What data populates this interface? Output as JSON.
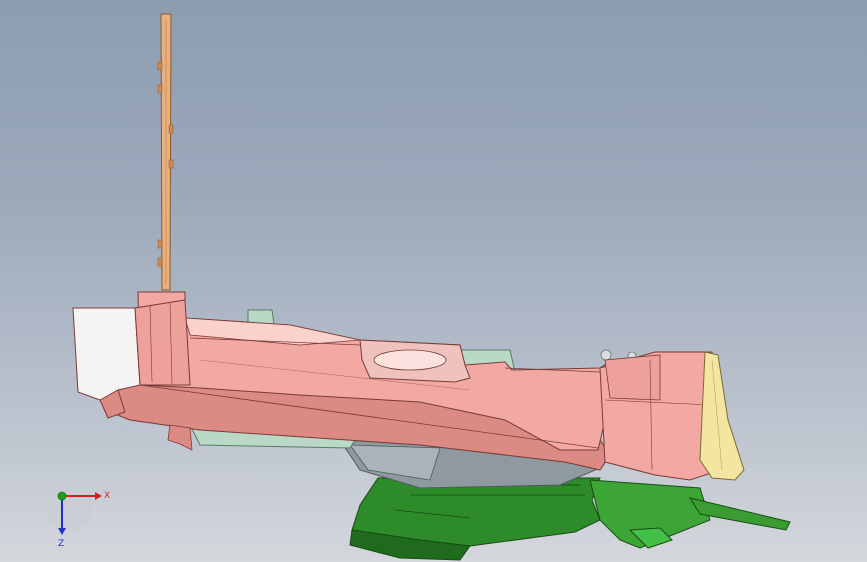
{
  "viewer": {
    "background_top": "#8d9cb0",
    "background_bottom": "#d4d7dc"
  },
  "model": {
    "colors": {
      "main_body": "#f2a9a4",
      "main_body_dark": "#dc8a84",
      "main_body_light": "#fbd1cc",
      "vertical_plate": "#e8b07e",
      "base_green": "#2e8b2a",
      "base_green_dark": "#1f6a1d",
      "underside_mint": "#b9d8c6",
      "underside_grey": "#8e9aa0",
      "end_cap_yellow": "#f2e6a0",
      "white_block": "#f6f4f2"
    }
  },
  "triad": {
    "x_label": "X",
    "z_label": "Z",
    "x_color": "#d42020",
    "y_color": "#20a020",
    "z_color": "#2030c8"
  }
}
